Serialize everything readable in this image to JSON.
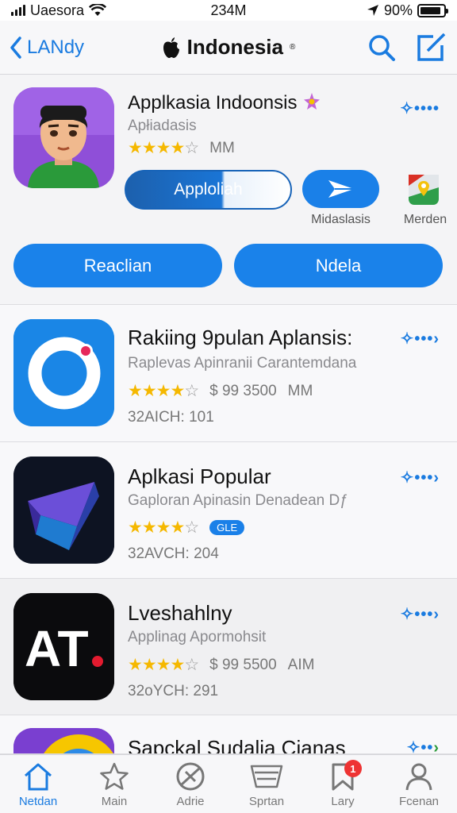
{
  "status_bar": {
    "carrier": "Uaesora",
    "time": "234M",
    "battery_text": "90%",
    "battery_level": 0.9
  },
  "nav": {
    "back_label": "LANdy",
    "title": "Indonesia",
    "title_mark": "®"
  },
  "featured": {
    "title": "Applkasia Indoonsis",
    "subtitle": "Apłiadasis",
    "rating_stars": 4,
    "rating_meta": "MM",
    "get_label": "Apploliah",
    "play_label": "Midaslasis",
    "maps_label": "Merden",
    "button_left": "Reaclian",
    "button_right": "Ndela"
  },
  "apps": [
    {
      "title": "Rakiing 9pulan Aplansis:",
      "subtitle": "Raplevas Apinranii Carantemdana",
      "rating_stars": 4,
      "price": "$ 99 3500",
      "unit": "MM",
      "stat": "32AICH: 101"
    },
    {
      "title": "Aplkasi Popular",
      "subtitle": "Gaploran Apinasin Denadean Dƒ",
      "rating_stars": 4,
      "badge": "GLE",
      "stat": "32AVCH: 204"
    },
    {
      "title": "Lveshahlny",
      "subtitle": "Applinag Apormohsit",
      "rating_stars": 4,
      "price": "$ 99 5500",
      "unit": "AIM",
      "stat": "32oYCH: 291"
    },
    {
      "title": "Sapckal Sudalia Cianas"
    }
  ],
  "tabs": [
    {
      "label": "Netdan",
      "icon": "home-icon",
      "active": true
    },
    {
      "label": "Main",
      "icon": "star-icon"
    },
    {
      "label": "Adrie",
      "icon": "compass-icon"
    },
    {
      "label": "Sprtan",
      "icon": "tray-icon"
    },
    {
      "label": "Lary",
      "icon": "bookmark-icon",
      "badge": "1"
    },
    {
      "label": "Fcenan",
      "icon": "person-icon"
    }
  ],
  "colors": {
    "accent": "#1a7be0",
    "star": "#f5b800",
    "badge_red": "#e33333"
  }
}
